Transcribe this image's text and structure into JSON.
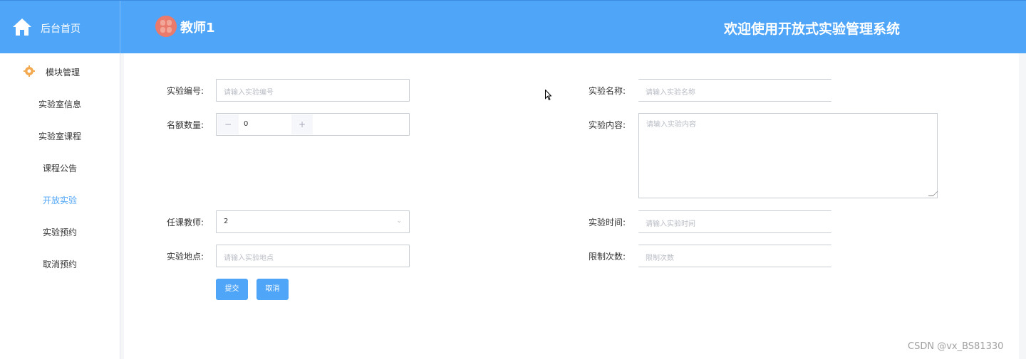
{
  "header": {
    "home_label": "后台首页",
    "user_name": "教师1",
    "system_title": "欢迎使用开放式实验管理系统",
    "accent_color": "#4fa5f7"
  },
  "sidebar": {
    "group_label": "模块管理",
    "group_icon": "gear-icon",
    "items": [
      {
        "label": "实验室信息"
      },
      {
        "label": "实验室课程"
      },
      {
        "label": "课程公告"
      },
      {
        "label": "开放实验"
      },
      {
        "label": "实验预约"
      },
      {
        "label": "取消预约"
      }
    ],
    "active_item": "开放实验"
  },
  "form": {
    "exp_no": {
      "label": "实验编号:",
      "placeholder": "请输入实验编号"
    },
    "exp_name": {
      "label": "实验名称:",
      "placeholder": "请输入实验名称"
    },
    "quota": {
      "label": "名额数量:",
      "value": "0",
      "minus": "−",
      "plus": "+"
    },
    "content": {
      "label": "实验内容:",
      "placeholder": "请输入实验内容"
    },
    "teacher": {
      "label": "任课教师:",
      "value": "2"
    },
    "time": {
      "label": "实验时间:",
      "placeholder": "请输入实验时间"
    },
    "location": {
      "label": "实验地点:",
      "placeholder": "请输入实验地点"
    },
    "limit": {
      "label": "限制次数:",
      "placeholder": "限制次数"
    },
    "submit_label": "提交",
    "cancel_label": "取消"
  },
  "watermark": "CSDN @vx_BS81330"
}
